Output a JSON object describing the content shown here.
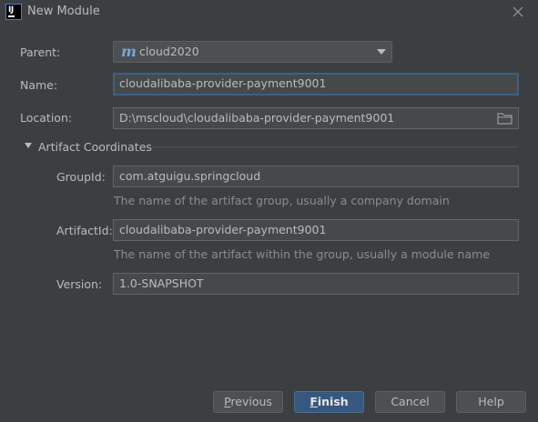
{
  "window": {
    "title": "New Module",
    "app_icon_text": "IJ"
  },
  "parent": {
    "label": "Parent:",
    "value": "cloud2020"
  },
  "name": {
    "label": "Name:",
    "value": "cloudalibaba-provider-payment9001"
  },
  "location": {
    "label": "Location:",
    "value": "D:\\mscloud\\cloudalibaba-provider-payment9001"
  },
  "artifact": {
    "section_title": "Artifact Coordinates",
    "group_id": {
      "label": "GroupId:",
      "value": "com.atguigu.springcloud",
      "hint": "The name of the artifact group, usually a company domain"
    },
    "artifact_id": {
      "label": "ArtifactId:",
      "value": "cloudalibaba-provider-payment9001",
      "hint": "The name of the artifact within the group, usually a module name"
    },
    "version": {
      "label": "Version:",
      "value": "1.0-SNAPSHOT"
    }
  },
  "buttons": {
    "previous": {
      "mnemonic": "P",
      "rest": "revious"
    },
    "finish": {
      "mnemonic": "F",
      "rest": "inish"
    },
    "cancel": "Cancel",
    "help": "Help"
  },
  "colors": {
    "background": "#3c3f41",
    "field_background": "#45494a",
    "focus_border": "#3d6185",
    "primary_button": "#365880",
    "text": "#bbbbbb",
    "hint_text": "#8c8c8c",
    "maven_icon": "#7aa6d6"
  },
  "icons": {
    "app": "intellij-idea-icon",
    "close": "close-icon",
    "maven": "maven-m-icon",
    "dropdown": "chevron-down-icon",
    "folder": "folder-icon",
    "collapse": "triangle-down-icon"
  }
}
